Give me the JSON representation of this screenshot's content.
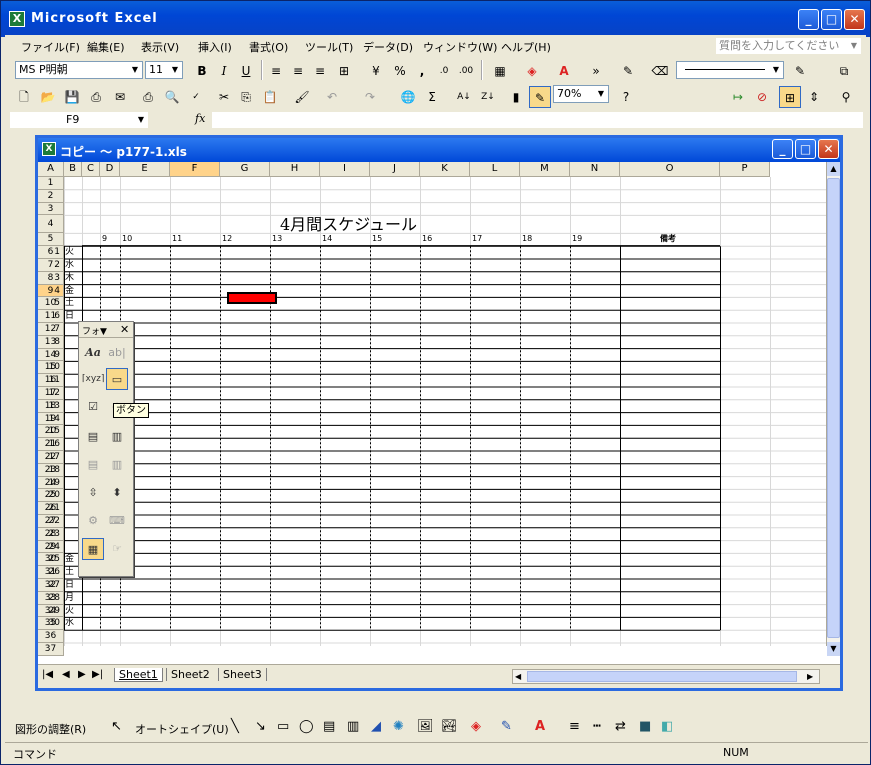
{
  "app": {
    "title": "Microsoft Excel"
  },
  "menu": [
    "ファイル(F)",
    "編集(E)",
    "表示(V)",
    "挿入(I)",
    "書式(O)",
    "ツール(T)",
    "データ(D)",
    "ウィンドウ(W)",
    "ヘルプ(H)"
  ],
  "help_box": {
    "placeholder": "質問を入力してください"
  },
  "format_bar": {
    "font": "MS P明朝",
    "size": "11"
  },
  "standard_bar": {
    "zoom": "70%"
  },
  "formula_bar": {
    "name_box": "F9",
    "fx": "fx",
    "value": ""
  },
  "workbook": {
    "title": "コピー 〜 p177-1.xls"
  },
  "columns": [
    "A",
    "B",
    "C",
    "D",
    "E",
    "F",
    "G",
    "H",
    "I",
    "J",
    "K",
    "L",
    "M",
    "N",
    "O",
    "P"
  ],
  "sheet_title": "4月間スケジュール",
  "time_headers": [
    "9",
    "10",
    "11",
    "12",
    "13",
    "14",
    "15",
    "16",
    "17",
    "18",
    "19"
  ],
  "notes_header": "備考",
  "row_numbers": [
    "1",
    "2",
    "3",
    "4",
    "5",
    "6",
    "7",
    "8",
    "9",
    "10",
    "11",
    "12",
    "13",
    "14",
    "15",
    "16",
    "17",
    "18",
    "19",
    "20",
    "21",
    "22",
    "23",
    "24",
    "25",
    "26",
    "27",
    "28",
    "29",
    "30",
    "31",
    "32",
    "33",
    "34",
    "35",
    "36",
    "37"
  ],
  "schedule_days": [
    {
      "d": "1",
      "w": "火"
    },
    {
      "d": "2",
      "w": "水"
    },
    {
      "d": "3",
      "w": "木"
    },
    {
      "d": "4",
      "w": "金"
    },
    {
      "d": "5",
      "w": "土"
    },
    {
      "d": "6",
      "w": "日"
    },
    {
      "d": "7",
      "w": ""
    },
    {
      "d": "8",
      "w": ""
    },
    {
      "d": "9",
      "w": ""
    },
    {
      "d": "10",
      "w": ""
    },
    {
      "d": "11",
      "w": ""
    },
    {
      "d": "12",
      "w": ""
    },
    {
      "d": "13",
      "w": ""
    },
    {
      "d": "14",
      "w": ""
    },
    {
      "d": "15",
      "w": ""
    },
    {
      "d": "16",
      "w": ""
    },
    {
      "d": "17",
      "w": ""
    },
    {
      "d": "18",
      "w": ""
    },
    {
      "d": "19",
      "w": ""
    },
    {
      "d": "20",
      "w": ""
    },
    {
      "d": "21",
      "w": ""
    },
    {
      "d": "22",
      "w": ""
    },
    {
      "d": "23",
      "w": ""
    },
    {
      "d": "24",
      "w": ""
    },
    {
      "d": "25",
      "w": "金"
    },
    {
      "d": "26",
      "w": "土"
    },
    {
      "d": "27",
      "w": "日"
    },
    {
      "d": "28",
      "w": "月"
    },
    {
      "d": "29",
      "w": "火"
    },
    {
      "d": "30",
      "w": "水"
    }
  ],
  "palette": {
    "title": "フォ▼",
    "tooltip": "ボタン"
  },
  "sheet_tabs": [
    "Sheet1",
    "Sheet2",
    "Sheet3"
  ],
  "draw_bar": {
    "draw": "図形の調整(R)",
    "autoshape": "オートシェイプ(U)"
  },
  "status": {
    "left": "コマンド",
    "num": "NUM"
  },
  "colors": {
    "selection_fill": "#FF0000",
    "title_blue": "#0A5ED8"
  }
}
